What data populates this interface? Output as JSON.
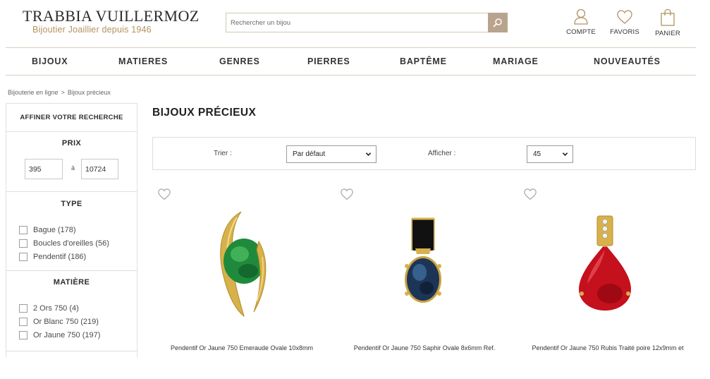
{
  "header": {
    "brand_name": "TRABBIA VUILLERMOZ",
    "tagline": "Bijoutier Joaillier depuis 1946",
    "search_placeholder": "Rechercher un bijou",
    "account_label": "COMPTE",
    "favorites_label": "FAVORIS",
    "cart_label": "PANIER"
  },
  "nav": {
    "items": [
      "BIJOUX",
      "MATIERES",
      "GENRES",
      "PIERRES",
      "BAPTÊME",
      "MARIAGE",
      "NOUVEAUTÉS"
    ]
  },
  "breadcrumb": {
    "items": [
      "Bijouterie en ligne",
      "Bijoux précieux"
    ],
    "separator": ">"
  },
  "sidebar": {
    "title": "AFFINER VOTRE RECHERCHE",
    "price": {
      "title": "PRIX",
      "min": "395",
      "separator": "à",
      "max": "10724"
    },
    "type": {
      "title": "TYPE",
      "options": [
        "Bague (178)",
        "Boucles d'oreilles (56)",
        "Pendentif (186)"
      ]
    },
    "material": {
      "title": "MATIÈRE",
      "options": [
        "2 Ors 750 (4)",
        "Or Blanc 750 (219)",
        "Or Jaune 750 (197)"
      ]
    }
  },
  "main": {
    "title": "BIJOUX PRÉCIEUX",
    "sort_label": "Trier :",
    "sort_value": "Par défaut",
    "display_label": "Afficher :",
    "display_value": "45"
  },
  "products": [
    {
      "name": "Pendentif Or Jaune 750 Emeraude Ovale 10x8mm",
      "stone": "emerald",
      "stone_color": "#1f8a3c"
    },
    {
      "name": "Pendentif Or Jaune 750 Saphir Ovale 8x6mm Ref.",
      "stone": "sapphire",
      "stone_color": "#1c3557"
    },
    {
      "name": "Pendentif Or Jaune 750 Rubis Traité poire 12x9mm et",
      "stone": "ruby",
      "stone_color": "#c5101d"
    }
  ],
  "colors": {
    "gold_accent": "#b29360",
    "search_button": "#b8a48e",
    "divider": "#d9cfbf"
  }
}
